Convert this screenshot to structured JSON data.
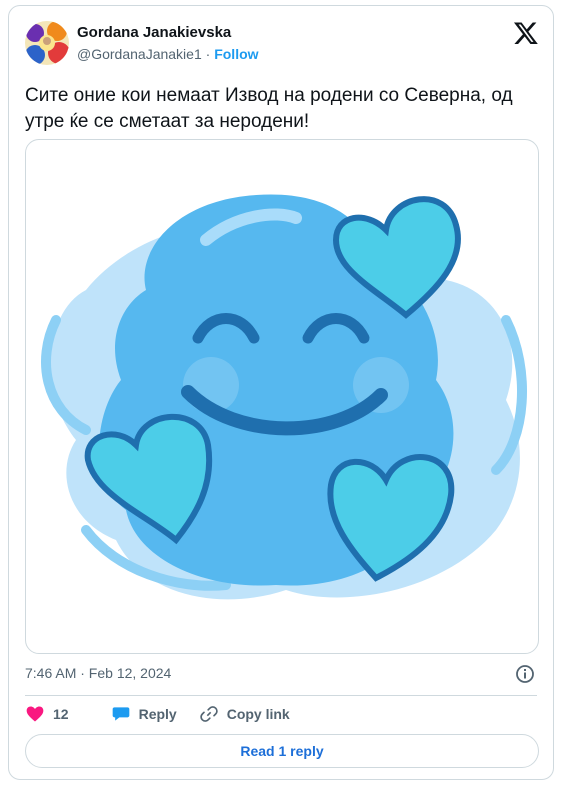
{
  "tweet": {
    "author_name": "Gordana Janakievska",
    "handle": "@GordanaJanakie1",
    "separator": " · ",
    "follow_label": "Follow",
    "text": "Сите оние кои немаат Извод на родени со Северна, од утре ќе се сметаат за неродени!",
    "timestamp": "7:46 AM · Feb 12, 2024"
  },
  "actions": {
    "like_count": "12",
    "reply_label": "Reply",
    "copy_link_label": "Copy link"
  },
  "footer": {
    "read_replies_label": "Read 1 reply"
  },
  "icons": {
    "brand": "x-logo-icon",
    "like": "heart-icon",
    "reply": "speech-bubble-icon",
    "copy": "link-icon",
    "info": "info-icon"
  },
  "colors": {
    "link_blue": "#1d9bf0",
    "like_pink": "#f91880",
    "emoji_blue": "#56b8ef"
  }
}
